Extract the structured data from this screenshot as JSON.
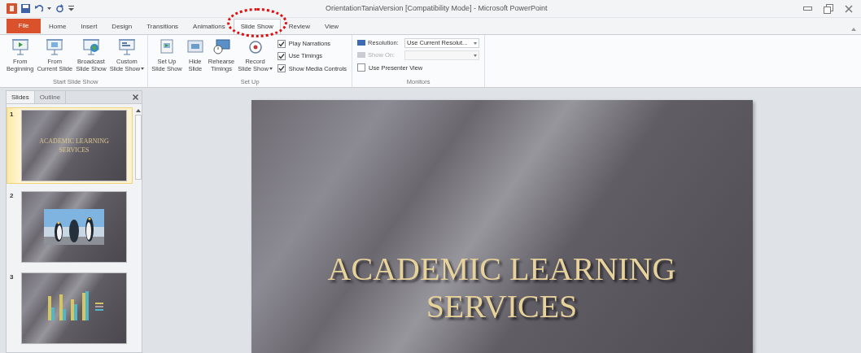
{
  "window": {
    "title": "OrientationTaniaVersion [Compatibility Mode] - Microsoft PowerPoint"
  },
  "tabs": [
    {
      "label": "File",
      "kind": "file",
      "selected": false,
      "circled": false
    },
    {
      "label": "Home",
      "kind": "tab",
      "selected": false,
      "circled": false
    },
    {
      "label": "Insert",
      "kind": "tab",
      "selected": false,
      "circled": false
    },
    {
      "label": "Design",
      "kind": "tab",
      "selected": false,
      "circled": false
    },
    {
      "label": "Transitions",
      "kind": "tab",
      "selected": false,
      "circled": false
    },
    {
      "label": "Animations",
      "kind": "tab",
      "selected": false,
      "circled": false
    },
    {
      "label": "Slide Show",
      "kind": "tab",
      "selected": true,
      "circled": true
    },
    {
      "label": "Review",
      "kind": "tab",
      "selected": false,
      "circled": false
    },
    {
      "label": "View",
      "kind": "tab",
      "selected": false,
      "circled": false
    }
  ],
  "ribbon": {
    "groups": [
      {
        "label": "Start Slide Show",
        "kind": "buttons",
        "buttons": [
          {
            "lines": [
              "From",
              "Beginning"
            ],
            "dropdown": false
          },
          {
            "lines": [
              "From",
              "Current Slide"
            ],
            "dropdown": false
          },
          {
            "lines": [
              "Broadcast",
              "Slide Show"
            ],
            "dropdown": false
          },
          {
            "lines": [
              "Custom",
              "Slide Show"
            ],
            "dropdown": true
          }
        ]
      },
      {
        "label": "Set Up",
        "kind": "buttons",
        "buttons": [
          {
            "lines": [
              "Set Up",
              "Slide Show"
            ],
            "dropdown": false
          },
          {
            "lines": [
              "Hide",
              "Slide"
            ],
            "dropdown": false
          },
          {
            "lines": [
              "Rehearse",
              "Timings"
            ],
            "dropdown": false
          },
          {
            "lines": [
              "Record",
              "Slide Show"
            ],
            "dropdown": true
          }
        ],
        "checkboxes": [
          {
            "label": "Play Narrations",
            "checked": true
          },
          {
            "label": "Use Timings",
            "checked": true
          },
          {
            "label": "Show Media Controls",
            "checked": true
          }
        ]
      },
      {
        "label": "Monitors",
        "kind": "monitors",
        "fields": [
          {
            "label": "Resolution:",
            "value": "Use Current Resolut...",
            "disabled": false
          },
          {
            "label": "Show On:",
            "disabled": true
          }
        ],
        "checkboxes": [
          {
            "label": "Use Presenter View",
            "checked": false
          }
        ]
      }
    ]
  },
  "slides_panel": {
    "tabs": [
      {
        "label": "Slides",
        "selected": true
      },
      {
        "label": "Outline",
        "selected": false
      }
    ],
    "slides": [
      {
        "number": "1",
        "kind": "title",
        "selected": true,
        "title": "ACADEMIC LEARNING SERVICES"
      },
      {
        "number": "2",
        "kind": "picture",
        "selected": false
      },
      {
        "number": "3",
        "kind": "chart",
        "selected": false
      }
    ]
  },
  "slide": {
    "title_lines": [
      "ACADEMIC LEARNING",
      "SERVICES"
    ]
  }
}
